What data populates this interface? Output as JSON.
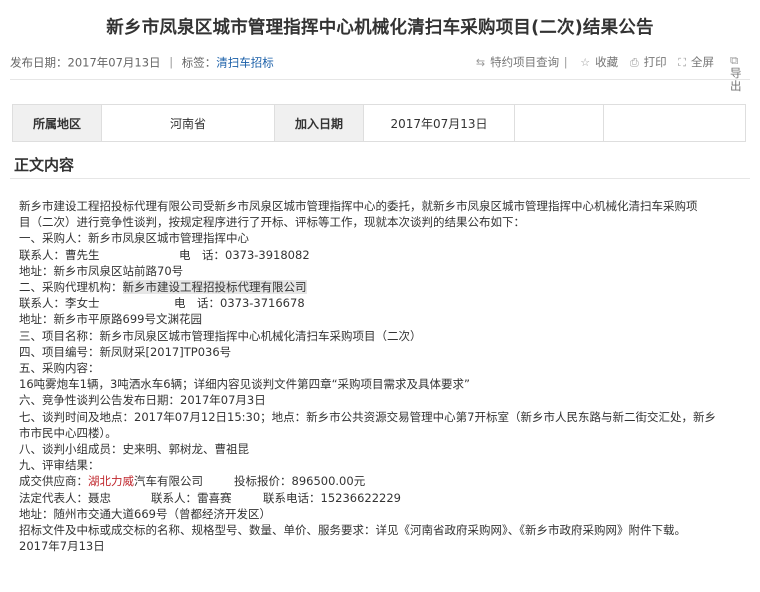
{
  "page_title": "新乡市凤泉区城市管理指挥中心机械化清扫车采购项目(二次)结果公告",
  "meta": {
    "publish_label": "发布日期：",
    "publish_date": "2017年07月13日",
    "tag_label": "标签：",
    "tag": "清扫车招标"
  },
  "tools": {
    "query": "特约项目查询",
    "favorite": "收藏",
    "print": "打印",
    "fullscreen": "全屏",
    "export": "导出"
  },
  "info": {
    "region_label": "所属地区",
    "region": "河南省",
    "date_label": "加入日期",
    "date": "2017年07月13日"
  },
  "section_title": "正文内容",
  "content": {
    "p1a": "新乡市建设工程招投标代理有限公司受新乡市凤泉区城市管理指挥中心的委托，就新乡市凤泉区城市管理指挥中心机械化清扫车采购项",
    "p1b": "目（二次）进行竞争性谈判，按规定程序进行了开标、评标等工作，现就本次谈判的结果公布如下：",
    "l1": "一、采购人：新乡市凤泉区城市管理指挥中心",
    "l2a": "联系人：曹先生",
    "l2b": "电　话：0373-3918082",
    "l3": "地址：新乡市凤泉区站前路70号",
    "l4a": "二、采购代理机构：",
    "l4b": "新乡市建设工程招投标代理有限公司",
    "l5a": "联系人：李女士",
    "l5b": "电　话：0373-3716678",
    "l6": "地址：新乡市平原路699号文渊花园",
    "l7": "三、项目名称：新乡市凤泉区城市管理指挥中心机械化清扫车采购项目（二次）",
    "l8": "四、项目编号：新凤财采[2017]TP036号",
    "l9": "五、采购内容：",
    "l10": "16吨雾炮车1辆，3吨洒水车6辆；详细内容见谈判文件第四章“采购项目需求及具体要求”",
    "l11": "六、竞争性谈判公告发布日期：2017年07月3日",
    "l12a": "七、谈判时间及地点：2017年07月12日15:30；地点：新乡市公共资源交易管理中心第7开标室（新乡市人民东路与新二街交汇处，新乡",
    "l12b": "市市民中心四楼）。",
    "l13": "八、谈判小组成员：史来明、郭树龙、曹祖昆",
    "l14": "九、评审结果：",
    "l15a": "成交供应商：",
    "l15b": "湖北力威",
    "l15c": "汽车有限公司",
    "l15d": "投标报价：896500.00元",
    "l16a": "法定代表人：聂忠",
    "l16b": "联系人：雷喜赛",
    "l16c": "联系电话：15236622229",
    "l17": "地址：随州市交通大道669号（曾都经济开发区）",
    "l18": "招标文件及中标或成交标的名称、规格型号、数量、单价、服务要求：详见《河南省政府采购网》、《新乡市政府采购网》附件下载。",
    "l19": "2017年7月13日"
  }
}
